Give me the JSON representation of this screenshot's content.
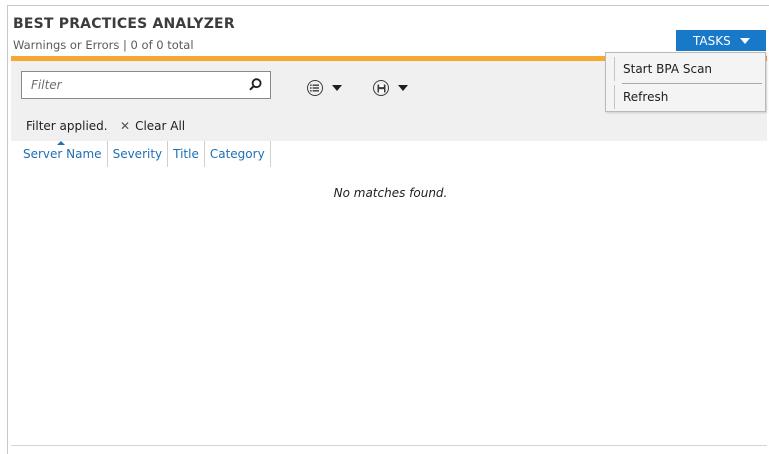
{
  "header": {
    "title": "BEST PRACTICES ANALYZER",
    "subtitle": "Warnings or Errors | 0 of 0 total"
  },
  "tasks": {
    "label": "TASKS",
    "menu": [
      "Start BPA Scan",
      "Refresh"
    ]
  },
  "filter": {
    "placeholder": "Filter",
    "value": "",
    "icons": [
      "search-icon",
      "list-options-icon",
      "save-query-icon"
    ]
  },
  "filter_status": {
    "applied_label": "Filter applied.",
    "clear_label": "Clear All"
  },
  "table": {
    "columns": [
      "Server Name",
      "Severity",
      "Title",
      "Category"
    ],
    "sorted_column": "Server Name",
    "empty_text": "No matches found."
  },
  "colors": {
    "accent": "#1979c9",
    "orange_bar": "#f5a935",
    "column_header_text": "#1f6fb5",
    "filter_bg": "#f0f0f0"
  }
}
